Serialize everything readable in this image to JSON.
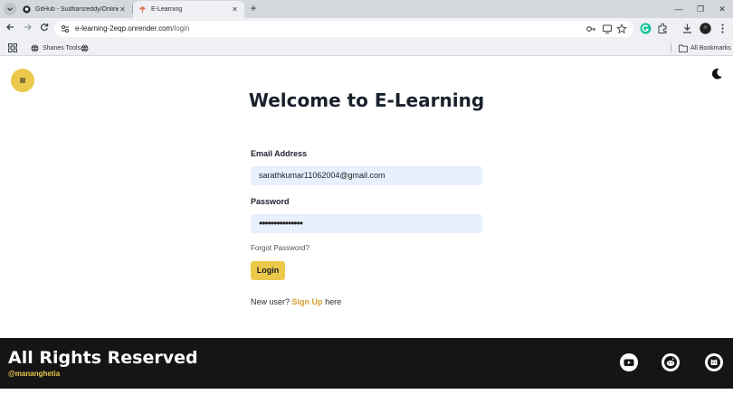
{
  "browser": {
    "tabs": [
      {
        "title": "GitHub - Sudharsreddy/Online",
        "active": false
      },
      {
        "title": "E-Learning",
        "active": true
      }
    ],
    "url_host": "e-learning-2eqp.onrender.com",
    "url_path": "/login",
    "bookmarks": {
      "shanes_tools": "Shanes Tools",
      "all_bookmarks": "All Bookmarks"
    }
  },
  "page": {
    "title": "Welcome to E-Learning",
    "email_label": "Email Address",
    "email_value": "sarathkumar11062004@gmail.com",
    "password_label": "Password",
    "password_value": "•••••••••••••••",
    "forgot_password": "Forgot Password?",
    "login_button": "Login",
    "signup_prefix": "New user?",
    "signup_link": "Sign Up",
    "signup_suffix": "here"
  },
  "footer": {
    "title": "All Rights Reserved",
    "handle": "@mananghetia",
    "social_icons": [
      "youtube-icon",
      "reddit-icon",
      "github-icon"
    ]
  },
  "colors": {
    "accent_yellow": "#ecc94b",
    "signup_link": "#d69e2e",
    "footer_bg": "#151515",
    "input_bg": "#e8f0fe"
  }
}
